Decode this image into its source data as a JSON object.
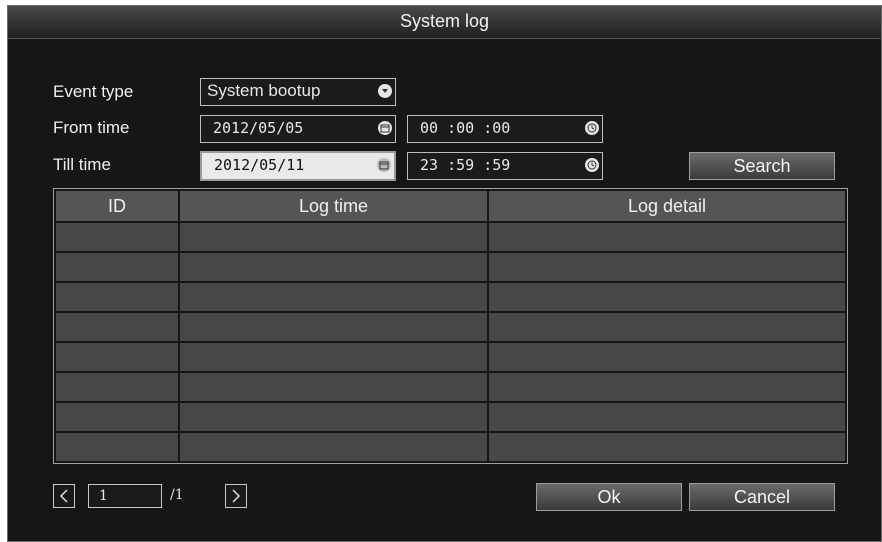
{
  "window": {
    "title": "System log"
  },
  "form": {
    "event_type_label": "Event type",
    "event_type_value": "System bootup",
    "from_time_label": "From time",
    "from_date": "2012/05/05",
    "from_clock": "00 :00 :00",
    "till_time_label": "Till time",
    "till_date": "2012/05/11",
    "till_clock": "23 :59 :59",
    "search_label": "Search"
  },
  "table": {
    "columns": [
      "ID",
      "Log time",
      "Log detail"
    ],
    "rows": [
      [
        "",
        "",
        ""
      ],
      [
        "",
        "",
        ""
      ],
      [
        "",
        "",
        ""
      ],
      [
        "",
        "",
        ""
      ],
      [
        "",
        "",
        ""
      ],
      [
        "",
        "",
        ""
      ],
      [
        "",
        "",
        ""
      ],
      [
        "",
        "",
        ""
      ]
    ]
  },
  "pager": {
    "current": "1",
    "total": "/1"
  },
  "buttons": {
    "ok": "Ok",
    "cancel": "Cancel"
  },
  "icons": {
    "dropdown": "chevron-down-icon",
    "calendar": "calendar-icon",
    "clock": "clock-icon",
    "prev": "chevron-left-icon",
    "next": "chevron-right-icon"
  }
}
